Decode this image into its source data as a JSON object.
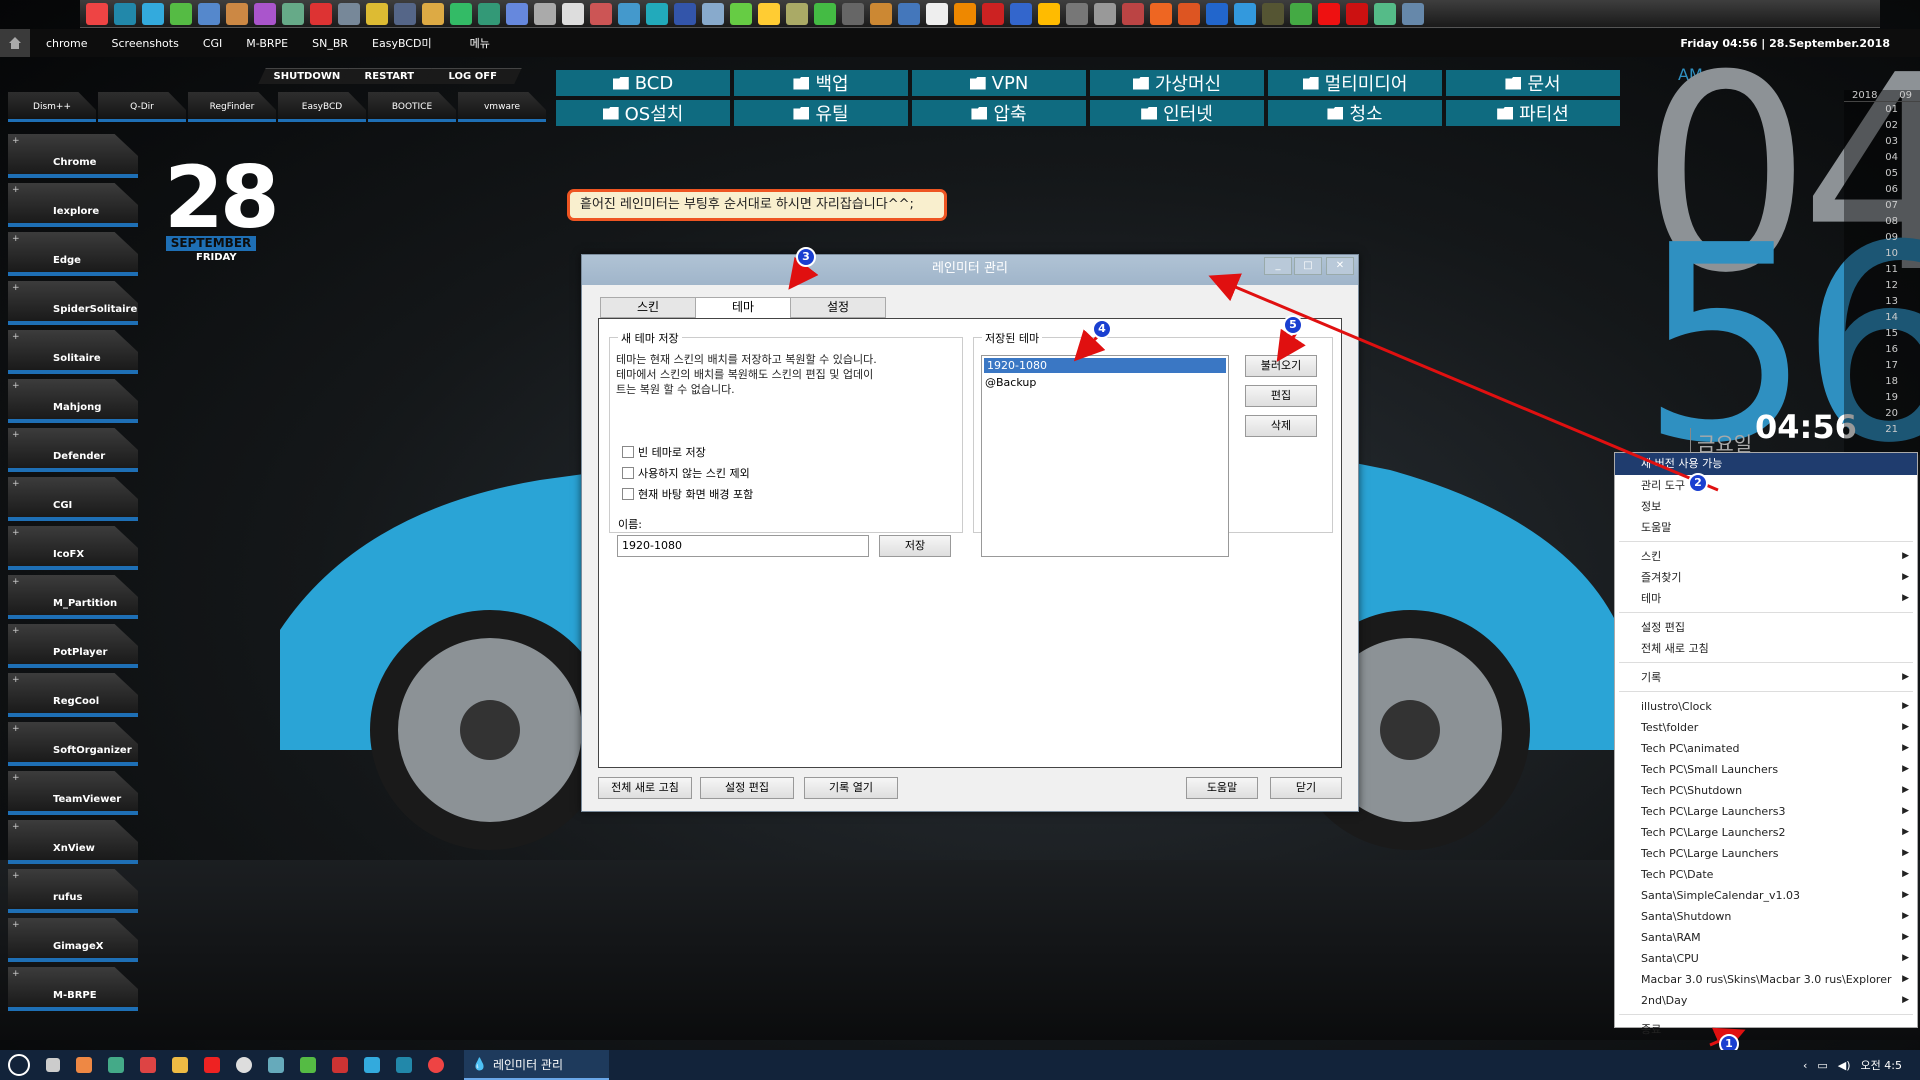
{
  "menubar": {
    "items": [
      "chrome",
      "Screenshots",
      "CGI",
      "M-BRPE",
      "SN_BR",
      "EasyBCD미",
      "메뉴"
    ],
    "datetime": "Friday 04:56 | 28.September.2018"
  },
  "power": [
    "SHUTDOWN",
    "RESTART",
    "LOG OFF"
  ],
  "tiles_small": [
    "Dism++",
    "Q-Dir",
    "RegFinder",
    "EasyBCD",
    "BOOTICE",
    "vmware"
  ],
  "launchers": [
    "Chrome",
    "Iexplore",
    "Edge",
    "SpiderSolitaire",
    "Solitaire",
    "Mahjong",
    "Defender",
    "CGI",
    "IcoFX",
    "M_Partition",
    "PotPlayer",
    "RegCool",
    "SoftOrganizer",
    "TeamViewer",
    "XnView",
    "rufus",
    "GimageX",
    "M-BRPE"
  ],
  "date": {
    "day": "28",
    "month": "SEPTEMBER",
    "weekday": "FRIDAY"
  },
  "folders": [
    "BCD",
    "백업",
    "VPN",
    "가상머신",
    "멀티미디어",
    "문서",
    "OS설치",
    "유틸",
    "압축",
    "인터넷",
    "청소",
    "파티션"
  ],
  "notice": "흩어진 레인미터는 부팅후 순서대로 하시면 자리잡습니다^^;",
  "clock": {
    "ampm": "AM",
    "hour": "04",
    "minute": "56",
    "weekday_kr": "금요일",
    "time": "04:56",
    "year": "2018",
    "month_num": "09",
    "days": [
      "01",
      "02",
      "03",
      "04",
      "05",
      "06",
      "07",
      "08",
      "09",
      "10",
      "11",
      "12",
      "13",
      "14",
      "15",
      "16",
      "17",
      "18",
      "19",
      "20",
      "21"
    ]
  },
  "dialog": {
    "title": "레인미터 관리",
    "tabs": [
      "스킨",
      "테마",
      "설정"
    ],
    "new_theme": {
      "title": "새 테마 저장",
      "desc1": "테마는 현재 스킨의 배치를 저장하고 복원할 수 있습니다.",
      "desc2": "테마에서 스킨의 배치를 복원해도 스킨의 편집 및 업데이",
      "desc3": "트는 복원 할 수 없습니다.",
      "opt1": "빈 테마로 저장",
      "opt2": "사용하지 않는 스킨 제외",
      "opt3": "현재 바탕 화면 배경 포함",
      "name_label": "이름:",
      "name_value": "1920-1080",
      "save": "저장"
    },
    "saved_theme": {
      "title": "저장된 테마",
      "items": [
        "1920-1080",
        "@Backup"
      ],
      "load": "불러오기",
      "edit": "편집",
      "delete": "삭제"
    },
    "footer": [
      "전체 새로 고침",
      "설정 편집",
      "기록 열기",
      "도움말",
      "닫기"
    ]
  },
  "context_menu": {
    "group1": [
      "새 버전 사용 가능",
      "관리 도구",
      "정보",
      "도움말"
    ],
    "group2": [
      "스킨",
      "즐겨찾기",
      "테마"
    ],
    "group3": [
      "설정 편집",
      "전체 새로 고침"
    ],
    "group4": [
      "기록"
    ],
    "skins": [
      "illustro\\Clock",
      "Test\\folder",
      "Tech PC\\animated",
      "Tech PC\\Small Launchers",
      "Tech PC\\Shutdown",
      "Tech PC\\Large Launchers3",
      "Tech PC\\Large Launchers2",
      "Tech PC\\Large Launchers",
      "Tech PC\\Date",
      "Santa\\SimpleCalendar_v1.03",
      "Santa\\Shutdown",
      "Santa\\RAM",
      "Santa\\CPU",
      "Macbar 3.0 rus\\Skins\\Macbar 3.0 rus\\Explorer",
      "2nd\\Day"
    ],
    "exit": "종료"
  },
  "badges": [
    "1",
    "2",
    "3",
    "4",
    "5"
  ],
  "taskbar": {
    "active_app": "레인미터 관리",
    "time": "오전 4:5"
  }
}
